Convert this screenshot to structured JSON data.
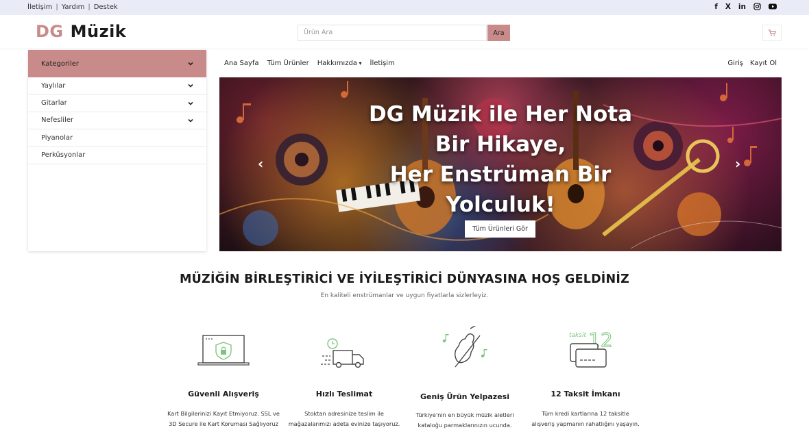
{
  "topbar": {
    "links": [
      "İletişim",
      "Yardım",
      "Destek"
    ],
    "social_icons": [
      "facebook-icon",
      "x-icon",
      "linkedin-icon",
      "instagram-icon",
      "youtube-icon"
    ]
  },
  "header": {
    "logo_prefix": "DG",
    "logo_name": "Müzik",
    "search_placeholder": "Ürün Ara",
    "search_button": "Ara",
    "cart_icon": "cart-icon"
  },
  "sidebar": {
    "title": "Kategoriler",
    "items": [
      {
        "label": "Yaylılar",
        "has_children": true
      },
      {
        "label": "Gitarlar",
        "has_children": true
      },
      {
        "label": "Nefesliler",
        "has_children": true
      },
      {
        "label": "Piyanolar",
        "has_children": false
      },
      {
        "label": "Perküsyonlar",
        "has_children": false
      }
    ]
  },
  "nav": {
    "items": [
      "Ana Sayfa",
      "Tüm Ürünler",
      "Hakkımızda",
      "İletişim"
    ],
    "login": "Giriş",
    "register": "Kayıt Ol"
  },
  "hero": {
    "title_lines": [
      "DG Müzik ile Her Nota",
      "Bir Hikaye,",
      "Her Enstrüman Bir",
      "Yolculuk!"
    ],
    "button": "Tüm Ürünleri Gör"
  },
  "welcome": {
    "title": "MÜZİĞİN BİRLEŞTİRİCİ VE İYİLEŞTİRİCİ DÜNYASINA HOŞ GELDİNİZ",
    "subtitle": "En kaliteli enstrümanlar ve uygun fiyatlarla sizlerleyiz."
  },
  "features": [
    {
      "icon": "secure-laptop-icon",
      "title": "Güvenli Alışveriş",
      "desc_lines": [
        "Kart Bilgilerinizi Kayıt Etmiyoruz. SSL ve",
        "3D Secure ile Kart Koruması Sağlıyoruz"
      ]
    },
    {
      "icon": "delivery-truck-icon",
      "title": "Hızlı Teslimat",
      "desc_lines": [
        "Stoktan adresinize teslim ile",
        "mağazalarımızı adeta evinize taşıyoruz."
      ]
    },
    {
      "icon": "violin-icon",
      "title": "Geniş Ürün Yelpazesi",
      "desc_lines": [
        "Türkiye'nin en büyük müzik aletleri",
        "kataloğu parmaklarınızın ucunda."
      ]
    },
    {
      "icon": "installment-cards-icon",
      "title": "12 Taksit İmkanı",
      "icon_text": [
        "taksit",
        "12"
      ],
      "desc_lines": [
        "Tüm kredi kartlarına 12 taksitle",
        "alışveriş yapmanın rahatlığını yaşayın."
      ]
    }
  ],
  "colors": {
    "accent": "#c98a8a",
    "topbar_bg": "#e9ecf6",
    "feature_green": "#7cc67c"
  }
}
